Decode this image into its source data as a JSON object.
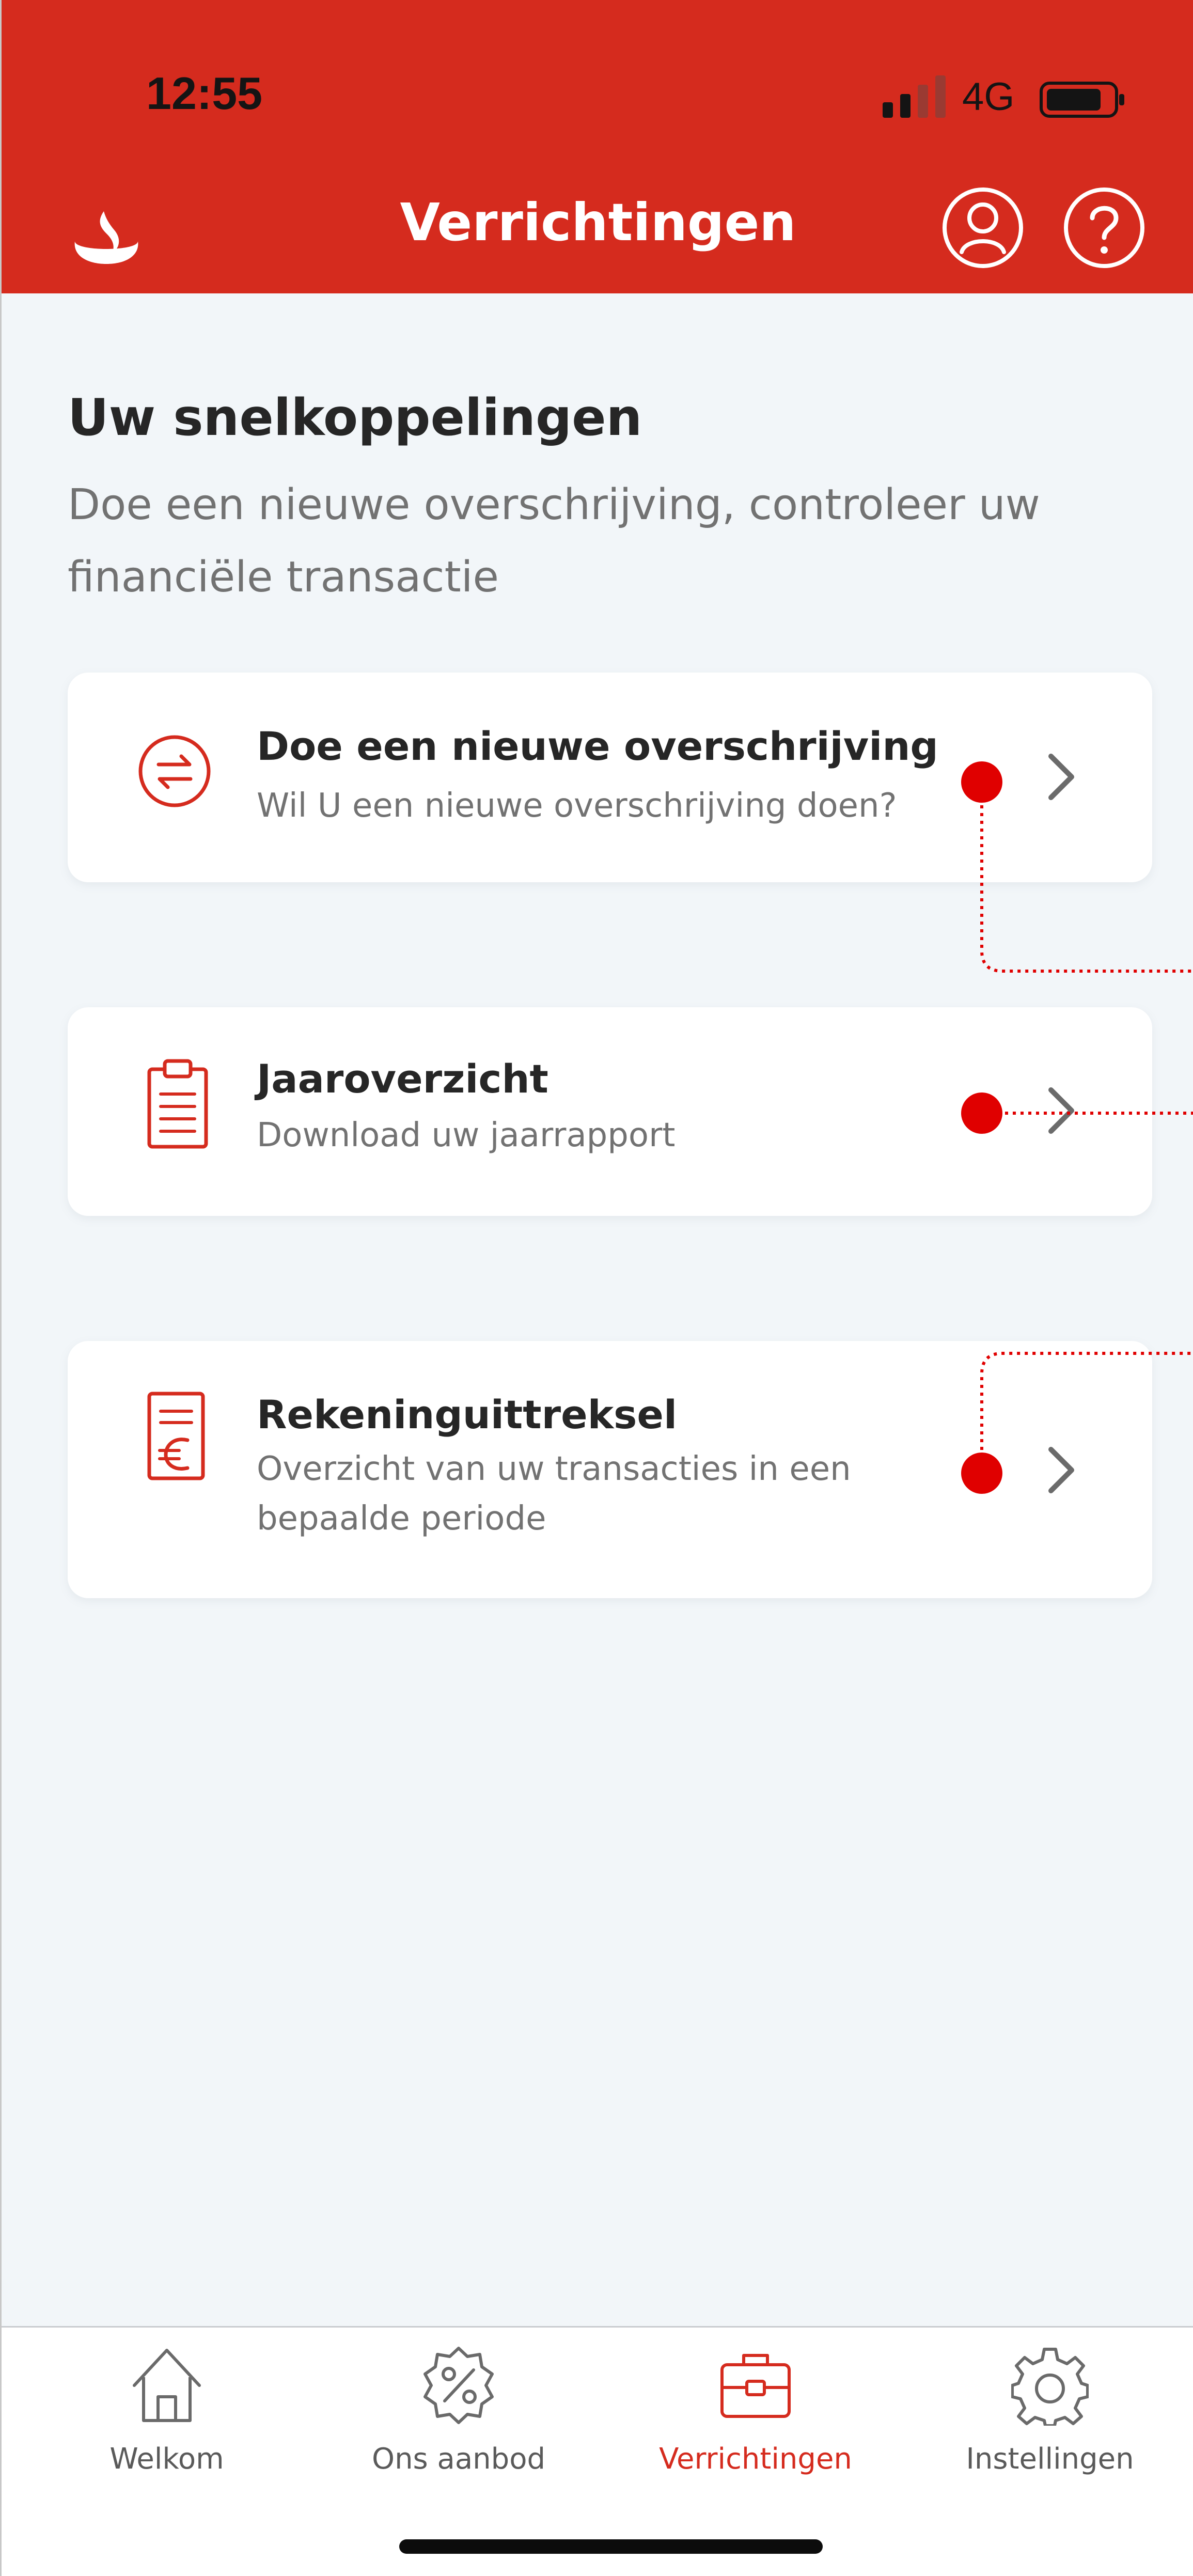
{
  "status_bar": {
    "time": "12:55",
    "network": "4G"
  },
  "header": {
    "title": "Verrichtingen"
  },
  "shortcuts": {
    "title": "Uw snelkoppelingen",
    "subtitle": "Doe een nieuwe overschrijving, controleer uw financiële transactie",
    "items": [
      {
        "title": "Doe een nieuwe overschrijving",
        "description": "Wil U een nieuwe overschrijving doen?",
        "icon": "transfer-icon"
      },
      {
        "title": "Jaaroverzicht",
        "description": "Download uw jaarrapport",
        "icon": "clipboard-icon"
      },
      {
        "title": "Rekeninguittreksel",
        "description": "Overzicht van uw transacties in een bepaalde periode",
        "icon": "euro-statement-icon"
      }
    ]
  },
  "tabbar": {
    "tabs": [
      {
        "label": "Welkom",
        "icon": "home-icon",
        "active": false
      },
      {
        "label": "Ons aanbod",
        "icon": "offer-percent-icon",
        "active": false
      },
      {
        "label": "Verrichtingen",
        "icon": "briefcase-icon",
        "active": true
      },
      {
        "label": "Instellingen",
        "icon": "gear-icon",
        "active": false
      }
    ]
  },
  "colors": {
    "brand_red": "#d52b1e",
    "background": "#f2f6f9",
    "text_dark": "#262626",
    "text_muted": "#727272",
    "tab_inactive": "#5a5a5a",
    "annotation_marker": "#e00000"
  }
}
